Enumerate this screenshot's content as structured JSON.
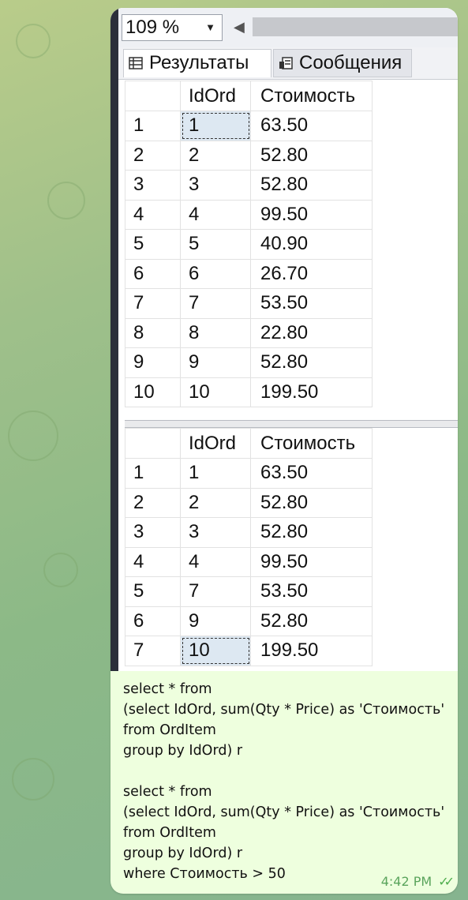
{
  "zoom": {
    "value": "109 %"
  },
  "tabs": [
    {
      "label": "Результаты",
      "icon": "grid-icon",
      "active": true
    },
    {
      "label": "Сообщения",
      "icon": "messages-icon",
      "active": false
    }
  ],
  "results": [
    {
      "columns": [
        "",
        "IdOrd",
        "Стоимость"
      ],
      "rows": [
        [
          "1",
          "1",
          "63.50"
        ],
        [
          "2",
          "2",
          "52.80"
        ],
        [
          "3",
          "3",
          "52.80"
        ],
        [
          "4",
          "4",
          "99.50"
        ],
        [
          "5",
          "5",
          "40.90"
        ],
        [
          "6",
          "6",
          "26.70"
        ],
        [
          "7",
          "7",
          "53.50"
        ],
        [
          "8",
          "8",
          "22.80"
        ],
        [
          "9",
          "9",
          "52.80"
        ],
        [
          "10",
          "10",
          "199.50"
        ]
      ]
    },
    {
      "columns": [
        "",
        "IdOrd",
        "Стоимость"
      ],
      "rows": [
        [
          "1",
          "1",
          "63.50"
        ],
        [
          "2",
          "2",
          "52.80"
        ],
        [
          "3",
          "3",
          "52.80"
        ],
        [
          "4",
          "4",
          "99.50"
        ],
        [
          "5",
          "7",
          "53.50"
        ],
        [
          "6",
          "9",
          "52.80"
        ],
        [
          "7",
          "10",
          "199.50"
        ]
      ]
    }
  ],
  "message": {
    "lines": [
      "select * from",
      "(select IdOrd, sum(Qty * Price) as 'Стоимость'",
      "from OrdItem",
      "group by IdOrd) r",
      "",
      "select * from",
      "(select IdOrd, sum(Qty * Price) as 'Стоимость'",
      "from OrdItem",
      "group by IdOrd) r",
      "where Стоимость > 50"
    ],
    "time": "4:42 PM",
    "status_icon": "double-check-icon"
  },
  "colors": {
    "bubble": "#eeffde",
    "time": "#5aa45c"
  }
}
